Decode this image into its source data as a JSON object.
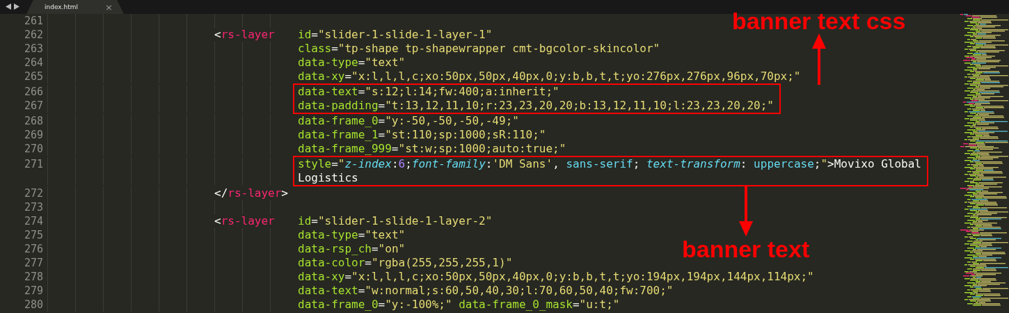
{
  "tab_bar": {
    "tabs": [
      {
        "label": "index.html",
        "close": "×",
        "selected": true
      }
    ]
  },
  "editor": {
    "blocks": [
      {
        "highlighted": false,
        "lines": [
          {
            "number": "261"
          },
          {
            "number": "262",
            "tag": [
              {
                "text": "<",
                "kind": "punct"
              },
              {
                "text": "rs-layer",
                "kind": "tag"
              }
            ],
            "tokens": [
              {
                "text": "id",
                "kind": "attr"
              },
              {
                "text": "=",
                "kind": "punct"
              },
              {
                "text": "\"slider-1-slide-1-layer-1\"",
                "kind": "str"
              }
            ]
          },
          {
            "number": "263",
            "tokens": [
              {
                "text": "class",
                "kind": "attr"
              },
              {
                "text": "=",
                "kind": "punct"
              },
              {
                "text": "\"tp-shape tp-shapewrapper cmt-bgcolor-skincolor\"",
                "kind": "str"
              }
            ]
          },
          {
            "number": "264",
            "tokens": [
              {
                "text": "data-type",
                "kind": "attr"
              },
              {
                "text": "=",
                "kind": "punct"
              },
              {
                "text": "\"text\"",
                "kind": "str"
              }
            ]
          },
          {
            "number": "265",
            "tokens": [
              {
                "text": "data-xy",
                "kind": "attr"
              },
              {
                "text": "=",
                "kind": "punct"
              },
              {
                "text": "\"x:l,l,l,c;xo:50px,50px,40px,0;y:b,b,t,t;yo:276px,276px,96px,70px;\"",
                "kind": "str"
              }
            ]
          }
        ]
      },
      {
        "highlighted": true,
        "annotation": {
          "text": "banner text css",
          "kind": "arrow-up"
        },
        "lines": [
          {
            "number": "266",
            "tokens": [
              {
                "text": "data-text",
                "kind": "attr"
              },
              {
                "text": "=",
                "kind": "punct"
              },
              {
                "text": "\"s:12;l:14;fw:400;a:inherit;\"",
                "kind": "str"
              }
            ]
          },
          {
            "number": "267",
            "tokens": [
              {
                "text": "data-padding",
                "kind": "attr"
              },
              {
                "text": "=",
                "kind": "punct"
              },
              {
                "text": "\"t:13,12,11,10;r:23,23,20,20;b:13,12,11,10;l:23,23,20,20;\"",
                "kind": "str"
              }
            ]
          }
        ]
      },
      {
        "highlighted": false,
        "lines": [
          {
            "number": "268",
            "tokens": [
              {
                "text": "data-frame_0",
                "kind": "attr"
              },
              {
                "text": "=",
                "kind": "punct"
              },
              {
                "text": "\"y:-50,-50,-50,-49;\"",
                "kind": "str"
              }
            ]
          },
          {
            "number": "269",
            "tokens": [
              {
                "text": "data-frame_1",
                "kind": "attr"
              },
              {
                "text": "=",
                "kind": "punct"
              },
              {
                "text": "\"st:110;sp:1000;sR:110;\"",
                "kind": "str"
              }
            ]
          },
          {
            "number": "270",
            "tokens": [
              {
                "text": "data-frame_999",
                "kind": "attr"
              },
              {
                "text": "=",
                "kind": "punct"
              },
              {
                "text": "\"st:w;sp:1000;auto:true;\"",
                "kind": "str"
              }
            ]
          }
        ]
      },
      {
        "highlighted": true,
        "annotation": {
          "text": "banner text",
          "kind": "arrow-down"
        },
        "lines": [
          {
            "number": "271",
            "tokens": [
              {
                "text": "style",
                "kind": "attr"
              },
              {
                "text": "=",
                "kind": "punct"
              },
              {
                "text": "\"",
                "kind": "str"
              },
              {
                "text": "z-index",
                "kind": "prop"
              },
              {
                "text": ":",
                "kind": "punct"
              },
              {
                "text": "6",
                "kind": "num"
              },
              {
                "text": ";",
                "kind": "punct"
              },
              {
                "text": "font-family",
                "kind": "prop"
              },
              {
                "text": ":",
                "kind": "punct"
              },
              {
                "text": "'DM Sans'",
                "kind": "str"
              },
              {
                "text": ", ",
                "kind": "punct"
              },
              {
                "text": "sans-serif",
                "kind": "val"
              },
              {
                "text": "; ",
                "kind": "punct"
              },
              {
                "text": "text-transform",
                "kind": "prop"
              },
              {
                "text": ": ",
                "kind": "punct"
              },
              {
                "text": "uppercase",
                "kind": "val"
              },
              {
                "text": ";",
                "kind": "punct"
              },
              {
                "text": "\"",
                "kind": "str"
              },
              {
                "text": ">Movixo Global",
                "kind": "text"
              }
            ]
          },
          {
            "tokens": [
              {
                "text": "Logistics",
                "kind": "text"
              }
            ]
          }
        ]
      },
      {
        "highlighted": false,
        "lines": [
          {
            "number": "272",
            "tag": [
              {
                "text": "</",
                "kind": "punct"
              },
              {
                "text": "rs-layer",
                "kind": "tag"
              },
              {
                "text": ">",
                "kind": "punct"
              }
            ]
          },
          {
            "number": "273"
          },
          {
            "number": "274",
            "tag": [
              {
                "text": "<",
                "kind": "punct"
              },
              {
                "text": "rs-layer",
                "kind": "tag"
              }
            ],
            "tokens": [
              {
                "text": "id",
                "kind": "attr"
              },
              {
                "text": "=",
                "kind": "punct"
              },
              {
                "text": "\"slider-1-slide-1-layer-2\"",
                "kind": "str"
              }
            ]
          },
          {
            "number": "275",
            "tokens": [
              {
                "text": "data-type",
                "kind": "attr"
              },
              {
                "text": "=",
                "kind": "punct"
              },
              {
                "text": "\"text\"",
                "kind": "str"
              }
            ]
          },
          {
            "number": "276",
            "tokens": [
              {
                "text": "data-rsp_ch",
                "kind": "attr"
              },
              {
                "text": "=",
                "kind": "punct"
              },
              {
                "text": "\"on\"",
                "kind": "str"
              }
            ]
          },
          {
            "number": "277",
            "tokens": [
              {
                "text": "data-color",
                "kind": "attr"
              },
              {
                "text": "=",
                "kind": "punct"
              },
              {
                "text": "\"rgba(255,255,255,1)\"",
                "kind": "str"
              }
            ]
          },
          {
            "number": "278",
            "tokens": [
              {
                "text": "data-xy",
                "kind": "attr"
              },
              {
                "text": "=",
                "kind": "punct"
              },
              {
                "text": "\"x:l,l,l,c;xo:50px,50px,40px,0;y:b,b,t,t;yo:194px,194px,144px,114px;\"",
                "kind": "str"
              }
            ]
          },
          {
            "number": "279",
            "tokens": [
              {
                "text": "data-text",
                "kind": "attr"
              },
              {
                "text": "=",
                "kind": "punct"
              },
              {
                "text": "\"w:normal;s:60,50,40,30;l:70,60,50,40;fw:700;\"",
                "kind": "str"
              }
            ]
          },
          {
            "number": "280",
            "tokens": [
              {
                "text": "data-frame_0",
                "kind": "attr"
              },
              {
                "text": "=",
                "kind": "punct"
              },
              {
                "text": "\"y:-100%;\"",
                "kind": "str"
              },
              {
                "text": " data-frame_0_mask",
                "kind": "attr"
              },
              {
                "text": "=",
                "kind": "punct"
              },
              {
                "text": "\"u:t;\"",
                "kind": "str"
              }
            ]
          }
        ]
      }
    ]
  }
}
